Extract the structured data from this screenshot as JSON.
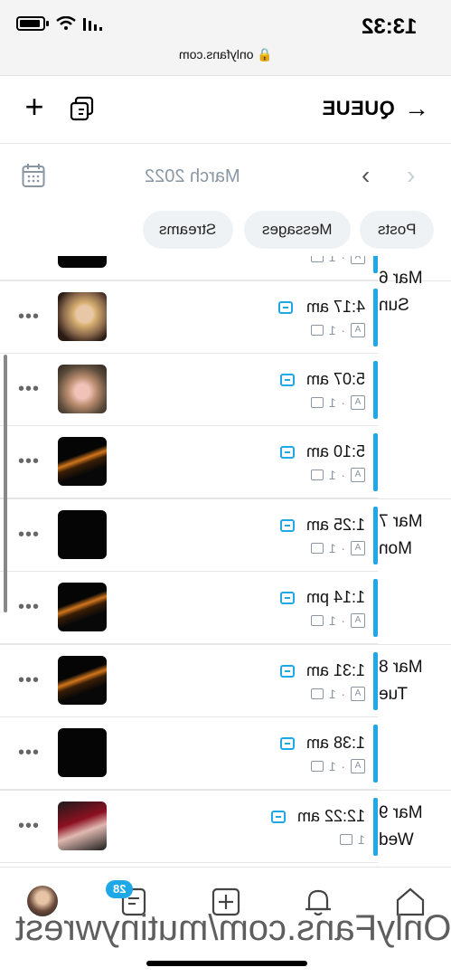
{
  "status_bar": {
    "time": "13:32",
    "url": "onlyfans.com"
  },
  "header": {
    "title": "QUEUE",
    "back_icon": "arrow-left-icon",
    "add_icon": "plus-icon",
    "queue_icon": "queue-list-icon"
  },
  "month_nav": {
    "label": "March 2022",
    "calendar_icon": "calendar-icon"
  },
  "filters": {
    "posts": "Posts",
    "messages": "Messages",
    "streams": "Streams"
  },
  "days": [
    {
      "date": "Mar 6",
      "weekday": "Sun"
    },
    {
      "date": "Mar 7",
      "weekday": "Mon"
    },
    {
      "date": "Mar 8",
      "weekday": "Tue"
    },
    {
      "date": "Mar 9",
      "weekday": "Wed"
    }
  ],
  "entries": [
    {
      "time": "4:17 am",
      "count": "1"
    },
    {
      "time": "5:07 am",
      "count": "1"
    },
    {
      "time": "5:10 am",
      "count": "1"
    },
    {
      "time": "1:25 am",
      "count": "1"
    },
    {
      "time": "1:14 pm",
      "count": "1"
    },
    {
      "time": "1:31 am",
      "count": "1"
    },
    {
      "time": "1:38 am",
      "count": "1"
    },
    {
      "time": "12:22 am",
      "count": "1"
    }
  ],
  "partial_top": {
    "count": "1"
  },
  "bottom_nav": {
    "badge": "28"
  },
  "watermark": "OnlyFans.com/mutinywrest"
}
